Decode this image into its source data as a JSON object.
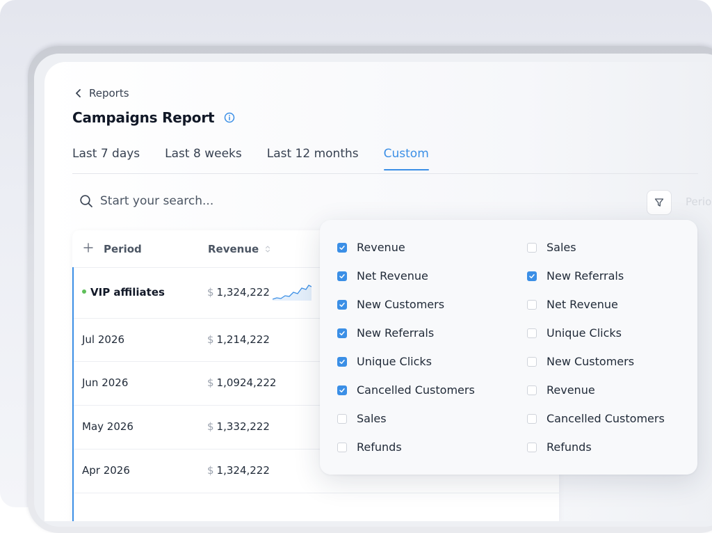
{
  "breadcrumb": {
    "back_label": "Reports"
  },
  "page": {
    "title": "Campaigns Report"
  },
  "tabs": [
    {
      "label": "Last 7 days",
      "active": false
    },
    {
      "label": "Last 8 weeks",
      "active": false
    },
    {
      "label": "Last 12 months",
      "active": false
    },
    {
      "label": "Custom",
      "active": true
    }
  ],
  "search": {
    "placeholder": "Start your search..."
  },
  "toolbar": {
    "period_label": "Perio"
  },
  "table": {
    "columns": {
      "period": "Period",
      "revenue": "Revenue"
    },
    "currency": "$",
    "rows": [
      {
        "period": "VIP affiliates",
        "revenue": "1,324,222",
        "highlight": true
      },
      {
        "period": "Jul 2026",
        "revenue": "1,214,222"
      },
      {
        "period": "Jun 2026",
        "revenue": "1,0924,222"
      },
      {
        "period": "May 2026",
        "revenue": "1,332,222"
      },
      {
        "period": "Apr 2026",
        "revenue": "1,324,222"
      }
    ]
  },
  "column_picker": {
    "left": [
      {
        "label": "Revenue",
        "checked": true
      },
      {
        "label": "Net Revenue",
        "checked": true
      },
      {
        "label": "New Customers",
        "checked": true
      },
      {
        "label": "New Referrals",
        "checked": true
      },
      {
        "label": "Unique Clicks",
        "checked": true
      },
      {
        "label": "Cancelled Customers",
        "checked": true
      },
      {
        "label": "Sales",
        "checked": false
      },
      {
        "label": "Refunds",
        "checked": false
      }
    ],
    "right": [
      {
        "label": "Sales",
        "checked": false
      },
      {
        "label": "New Referrals",
        "checked": true
      },
      {
        "label": "Net Revenue",
        "checked": false
      },
      {
        "label": "Unique Clicks",
        "checked": false
      },
      {
        "label": "New Customers",
        "checked": false
      },
      {
        "label": "Revenue",
        "checked": false
      },
      {
        "label": "Cancelled Customers",
        "checked": false
      },
      {
        "label": "Refunds",
        "checked": false
      }
    ]
  },
  "colors": {
    "accent": "#3b8fe6",
    "status_active": "#5fbf5a"
  },
  "icons": [
    "chevron-left-icon",
    "info-icon",
    "search-icon",
    "filter-icon",
    "plus-icon",
    "sort-icon",
    "sparkline-chart",
    "checkbox-checked-icon"
  ]
}
